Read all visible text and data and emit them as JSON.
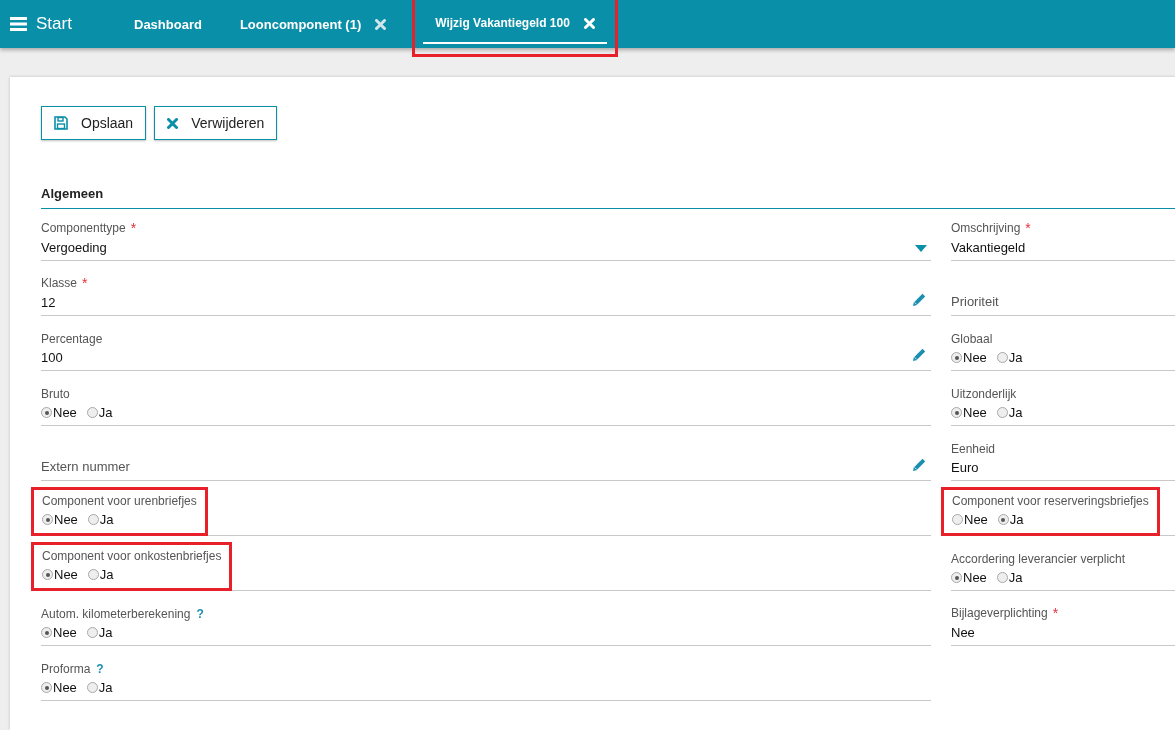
{
  "topbar": {
    "menu_label": "Start",
    "tabs": [
      {
        "label": "Dashboard",
        "selected": false,
        "closable": false,
        "highlighted": false
      },
      {
        "label": "Looncomponent (1)",
        "selected": false,
        "closable": true,
        "highlighted": false
      },
      {
        "label": "Wijzig Vakantiegeld 100",
        "selected": true,
        "closable": true,
        "highlighted": true
      }
    ]
  },
  "toolbar": [
    {
      "label": "Opslaan",
      "kind": "save"
    },
    {
      "label": "Verwijderen",
      "kind": "delete"
    }
  ],
  "section": {
    "title": "Algemeen"
  },
  "left_fields": [
    {
      "kind": "select",
      "label": "Componenttype",
      "required_mark": "*",
      "value": "Vergoeding"
    },
    {
      "kind": "text",
      "label": "Klasse",
      "required_mark": "*",
      "value": "12",
      "editable": true
    },
    {
      "kind": "text",
      "label": "Percentage",
      "value": "100",
      "editable": true
    },
    {
      "kind": "radio",
      "label": "Bruto",
      "options": [
        {
          "label": "Nee",
          "selected": true
        },
        {
          "label": "Ja",
          "selected": false
        }
      ]
    },
    {
      "kind": "empty",
      "label": "Extern nummer",
      "editable": true
    },
    {
      "kind": "radio",
      "label": "Component voor urenbriefjes",
      "highlighted": true,
      "options": [
        {
          "label": "Nee",
          "selected": true
        },
        {
          "label": "Ja",
          "selected": false
        }
      ]
    },
    {
      "kind": "radio",
      "label": "Component voor onkostenbriefjes",
      "highlighted": true,
      "options": [
        {
          "label": "Nee",
          "selected": true
        },
        {
          "label": "Ja",
          "selected": false
        }
      ]
    },
    {
      "kind": "radio",
      "label": "Autom. kilometerberekening",
      "help": "?",
      "options": [
        {
          "label": "Nee",
          "selected": true
        },
        {
          "label": "Ja",
          "selected": false
        }
      ]
    },
    {
      "kind": "radio",
      "label": "Proforma",
      "help": "?",
      "options": [
        {
          "label": "Nee",
          "selected": true
        },
        {
          "label": "Ja",
          "selected": false
        }
      ]
    }
  ],
  "right_fields": [
    {
      "kind": "text",
      "label": "Omschrijving",
      "required_mark": "*",
      "value": "Vakantiegeld"
    },
    {
      "kind": "empty",
      "label": "Prioriteit"
    },
    {
      "kind": "radio",
      "label": "Globaal",
      "options": [
        {
          "label": "Nee",
          "selected": true
        },
        {
          "label": "Ja",
          "selected": false
        }
      ]
    },
    {
      "kind": "radio",
      "label": "Uitzonderlijk",
      "options": [
        {
          "label": "Nee",
          "selected": true
        },
        {
          "label": "Ja",
          "selected": false
        }
      ]
    },
    {
      "kind": "text",
      "label": "Eenheid",
      "value": "Euro"
    },
    {
      "kind": "radio",
      "label": "Component voor reserveringsbriefjes",
      "highlighted": true,
      "options": [
        {
          "label": "Nee",
          "selected": false
        },
        {
          "label": "Ja",
          "selected": true
        }
      ]
    },
    {
      "kind": "radio",
      "label": "Accordering leverancier verplicht",
      "options": [
        {
          "label": "Nee",
          "selected": true
        },
        {
          "label": "Ja",
          "selected": false
        }
      ]
    },
    {
      "kind": "text",
      "label": "Bijlageverplichting",
      "required_mark": "*",
      "value": "Nee"
    }
  ]
}
